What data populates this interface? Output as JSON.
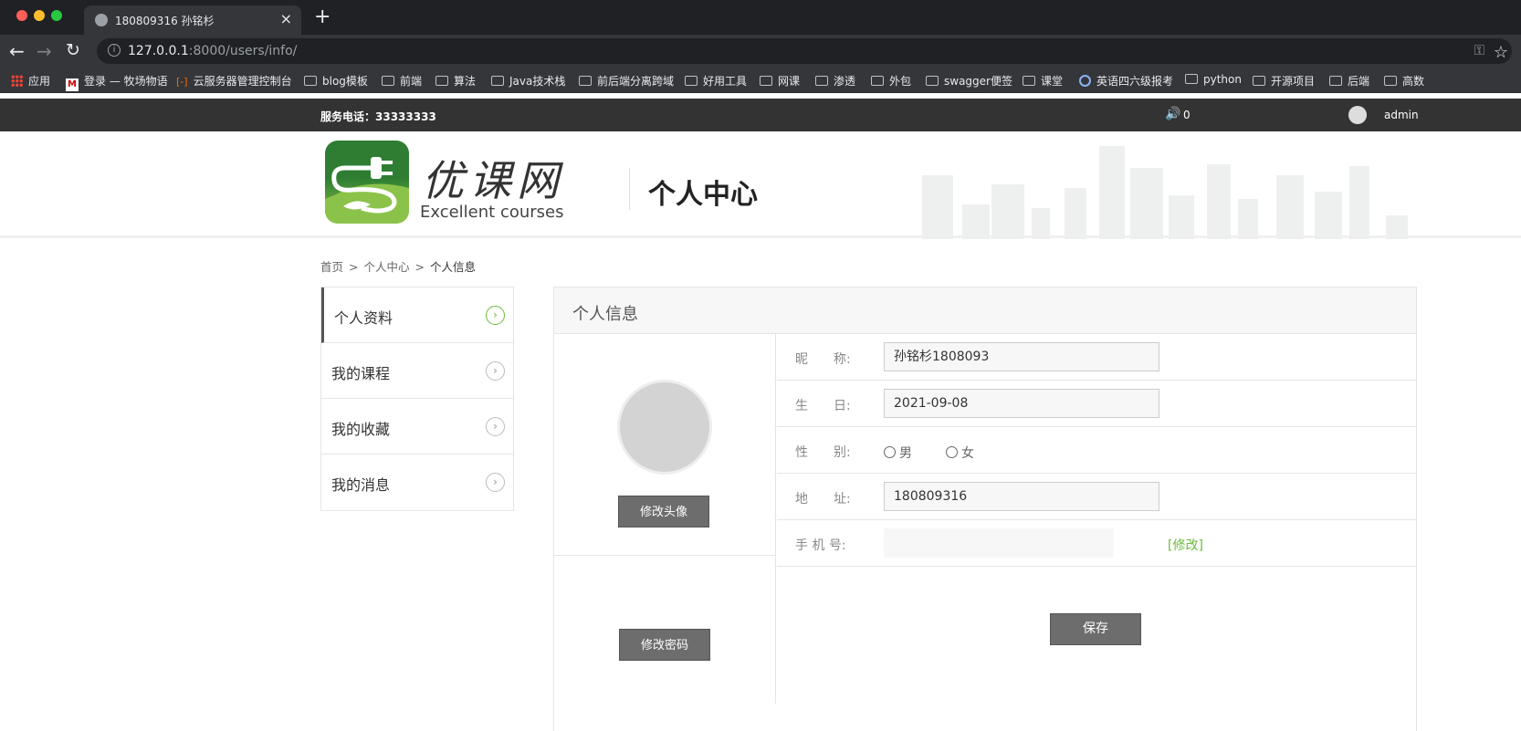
{
  "browser": {
    "tab_title": "180809316 孙铭杉",
    "url_host": "127.0.0.1",
    "url_path": ":8000/users/info/",
    "bookmarks": [
      "应用",
      "登录 — 牧场物语",
      "云服务器管理控制台",
      "blog模板",
      "前端",
      "算法",
      "Java技术栈",
      "前后端分离跨域",
      "好用工具",
      "网课",
      "渗透",
      "外包",
      "swagger便签",
      "课堂",
      "英语四六级报考",
      "python",
      "开源项目",
      "后端",
      "高数"
    ]
  },
  "topbar": {
    "phone": "服务电话：33333333",
    "message_count": "0",
    "username": "admin"
  },
  "header": {
    "logo_cn": "优课网",
    "logo_en": "Excellent courses",
    "title": "个人中心"
  },
  "breadcrumb": [
    "首页",
    ">",
    "个人中心",
    ">",
    "个人信息"
  ],
  "sidebar": {
    "items": [
      {
        "label": "个人资料",
        "active": true
      },
      {
        "label": "我的课程",
        "active": false
      },
      {
        "label": "我的收藏",
        "active": false
      },
      {
        "label": "我的消息",
        "active": false
      }
    ]
  },
  "main": {
    "title": "个人信息",
    "change_avatar": "修改头像",
    "change_password": "修改密码",
    "fields": {
      "nickname_label": "昵　　称:",
      "nickname_value": "孙铭杉1808093",
      "birthday_label": "生　　日:",
      "birthday_value": "2021-09-08",
      "gender_label": "性　　别:",
      "gender_male": "男",
      "gender_female": "女",
      "address_label": "地　　址:",
      "address_value": "180809316",
      "phone_label": "手 机 号:",
      "phone_value": "",
      "modify_link": "[修改]"
    },
    "save": "保存"
  },
  "colors": {
    "accent_green": "#6cbb3c",
    "topbar_bg": "#333333",
    "button_gray": "#6d6d6d"
  }
}
